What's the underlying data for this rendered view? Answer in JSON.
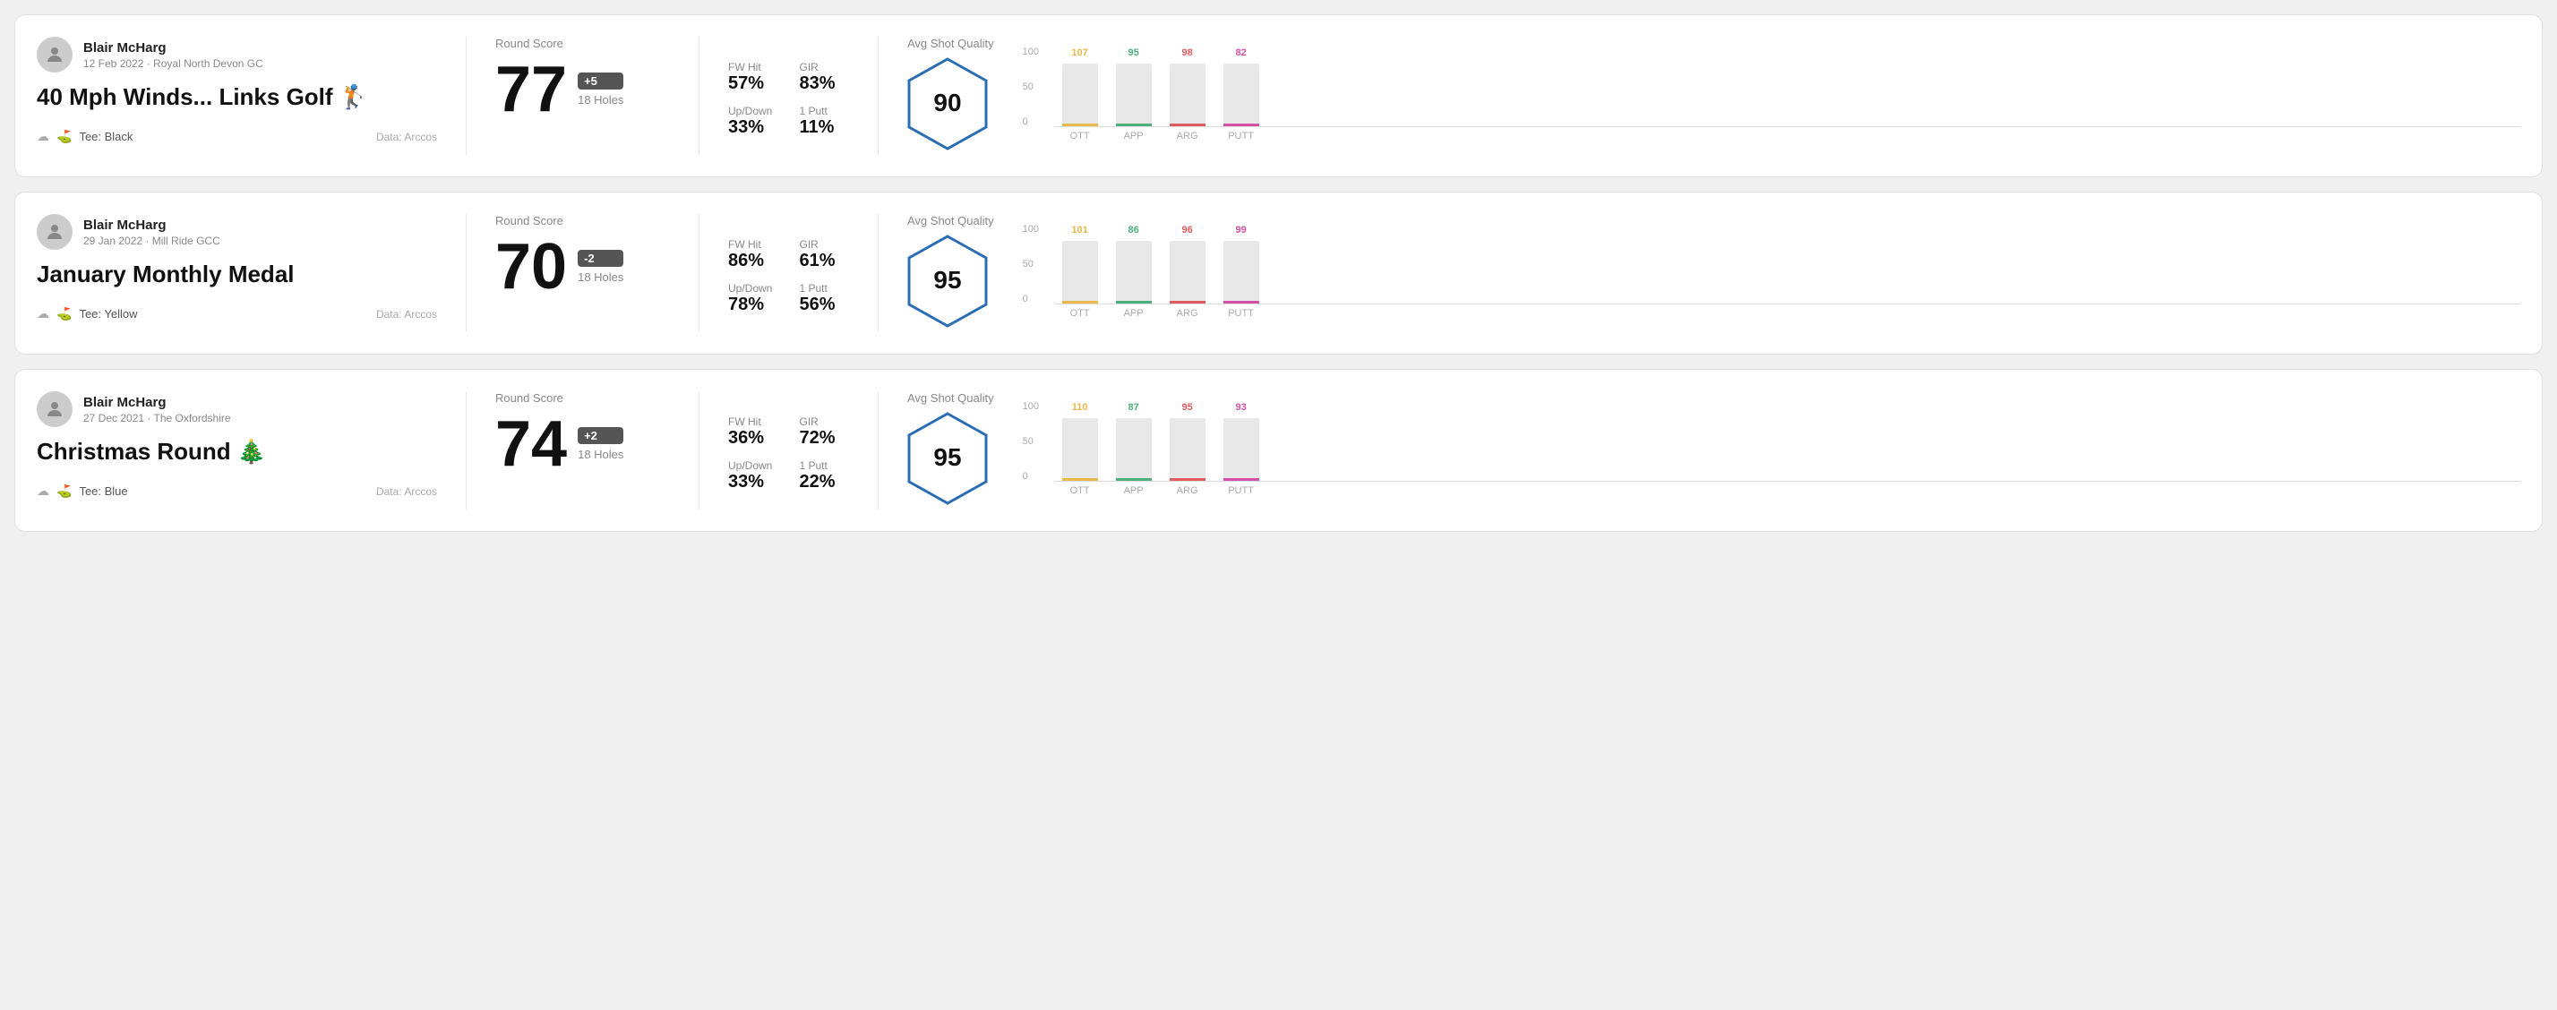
{
  "rounds": [
    {
      "id": "round1",
      "user": {
        "name": "Blair McHarg",
        "date": "12 Feb 2022",
        "course": "Royal North Devon GC"
      },
      "title": "40 Mph Winds... Links Golf 🏌",
      "tee": "Black",
      "data_source": "Data: Arccos",
      "score": "77",
      "score_diff": "+5",
      "holes": "18 Holes",
      "fw_hit": "57%",
      "gir": "83%",
      "up_down": "33%",
      "one_putt": "11%",
      "avg_shot_quality": "90",
      "chart": {
        "bars": [
          {
            "label": "OTT",
            "value": 107,
            "color": "#e8b84b"
          },
          {
            "label": "APP",
            "value": 95,
            "color": "#4caf7d"
          },
          {
            "label": "ARG",
            "value": 98,
            "color": "#e05c5c"
          },
          {
            "label": "PUTT",
            "value": 82,
            "color": "#d44fa8"
          }
        ]
      }
    },
    {
      "id": "round2",
      "user": {
        "name": "Blair McHarg",
        "date": "29 Jan 2022",
        "course": "Mill Ride GCC"
      },
      "title": "January Monthly Medal",
      "tee": "Yellow",
      "data_source": "Data: Arccos",
      "score": "70",
      "score_diff": "-2",
      "holes": "18 Holes",
      "fw_hit": "86%",
      "gir": "61%",
      "up_down": "78%",
      "one_putt": "56%",
      "avg_shot_quality": "95",
      "chart": {
        "bars": [
          {
            "label": "OTT",
            "value": 101,
            "color": "#e8b84b"
          },
          {
            "label": "APP",
            "value": 86,
            "color": "#4caf7d"
          },
          {
            "label": "ARG",
            "value": 96,
            "color": "#e05c5c"
          },
          {
            "label": "PUTT",
            "value": 99,
            "color": "#d44fa8"
          }
        ]
      }
    },
    {
      "id": "round3",
      "user": {
        "name": "Blair McHarg",
        "date": "27 Dec 2021",
        "course": "The Oxfordshire"
      },
      "title": "Christmas Round 🎄",
      "tee": "Blue",
      "data_source": "Data: Arccos",
      "score": "74",
      "score_diff": "+2",
      "holes": "18 Holes",
      "fw_hit": "36%",
      "gir": "72%",
      "up_down": "33%",
      "one_putt": "22%",
      "avg_shot_quality": "95",
      "chart": {
        "bars": [
          {
            "label": "OTT",
            "value": 110,
            "color": "#e8b84b"
          },
          {
            "label": "APP",
            "value": 87,
            "color": "#4caf7d"
          },
          {
            "label": "ARG",
            "value": 95,
            "color": "#e05c5c"
          },
          {
            "label": "PUTT",
            "value": 93,
            "color": "#d44fa8"
          }
        ]
      }
    }
  ],
  "labels": {
    "round_score": "Round Score",
    "fw_hit": "FW Hit",
    "gir": "GIR",
    "up_down": "Up/Down",
    "one_putt": "1 Putt",
    "avg_shot_quality": "Avg Shot Quality",
    "tee_prefix": "Tee:",
    "y_axis_100": "100",
    "y_axis_50": "50",
    "y_axis_0": "0"
  }
}
